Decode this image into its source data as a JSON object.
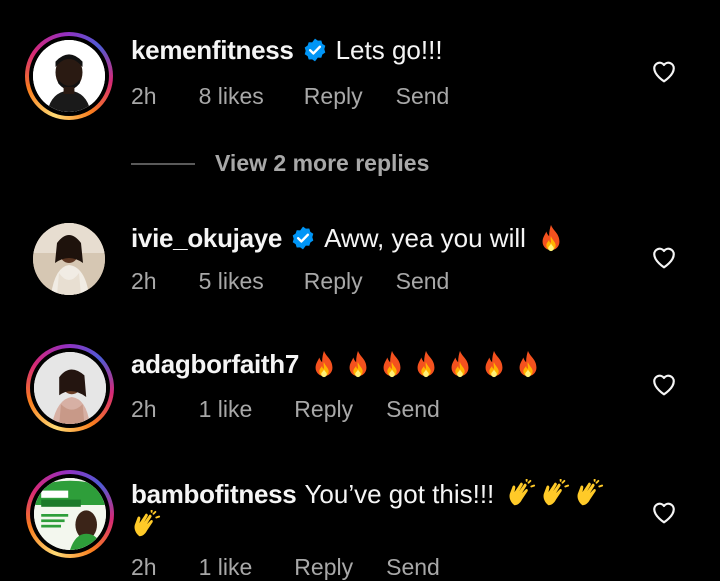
{
  "comments": [
    {
      "username": "kemenfitness",
      "verified": true,
      "text": "Lets go!!!",
      "time": "2h",
      "likes": "8 likes",
      "reply": "Reply",
      "send": "Send",
      "story_ring": true
    },
    {
      "username": "ivie_okujaye",
      "verified": true,
      "text": "Aww, yea you will",
      "emoji": [
        "fire"
      ],
      "time": "2h",
      "likes": "5 likes",
      "reply": "Reply",
      "send": "Send",
      "story_ring": false
    },
    {
      "username": "adagborfaith7",
      "verified": false,
      "text": "",
      "emoji": [
        "fire",
        "fire",
        "fire",
        "fire",
        "fire",
        "fire",
        "fire"
      ],
      "time": "2h",
      "likes": "1 like",
      "reply": "Reply",
      "send": "Send",
      "story_ring": true
    },
    {
      "username": "bambofitness",
      "verified": false,
      "text": "You’ve got this!!!",
      "emoji": [
        "clapping-hands",
        "clapping-hands",
        "clapping-hands",
        "clapping-hands"
      ],
      "time": "2h",
      "likes": "1 like",
      "reply": "Reply",
      "send": "Send",
      "story_ring": true
    }
  ],
  "view_more_replies": "View 2 more replies",
  "colors": {
    "background": "#000000",
    "primary_text": "#f5f5f5",
    "secondary_text": "#a8a8a8",
    "verified_blue": "#0095f6"
  },
  "icons": {
    "verified": "verified-badge-icon",
    "like": "heart-outline-icon",
    "fire": "fire-emoji",
    "clap": "clapping-hands-emoji"
  }
}
